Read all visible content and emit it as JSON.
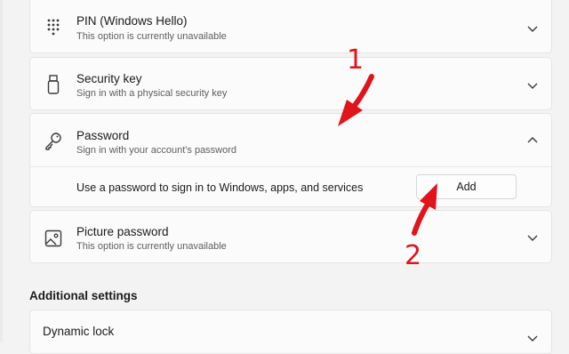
{
  "options": [
    {
      "title": "PIN (Windows Hello)",
      "subtitle": "This option is currently unavailable",
      "icon": "keypad-icon",
      "expanded": false
    },
    {
      "title": "Security key",
      "subtitle": "Sign in with a physical security key",
      "icon": "usb-key-icon",
      "expanded": false
    },
    {
      "title": "Password",
      "subtitle": "Sign in with your account's password",
      "icon": "key-icon",
      "expanded": true
    },
    {
      "title": "Picture password",
      "subtitle": "This option is currently unavailable",
      "icon": "picture-icon",
      "expanded": false
    }
  ],
  "password_panel": {
    "description": "Use a password to sign in to Windows, apps, and services",
    "add_label": "Add"
  },
  "additional": {
    "heading": "Additional settings",
    "dynamic_lock_title": "Dynamic lock"
  },
  "annotations": {
    "step1": "1",
    "step2": "2",
    "color": "#e0141b"
  },
  "colors": {
    "background": "#f3f3f3",
    "card": "#fbfbfb",
    "border": "#e5e5e5"
  }
}
